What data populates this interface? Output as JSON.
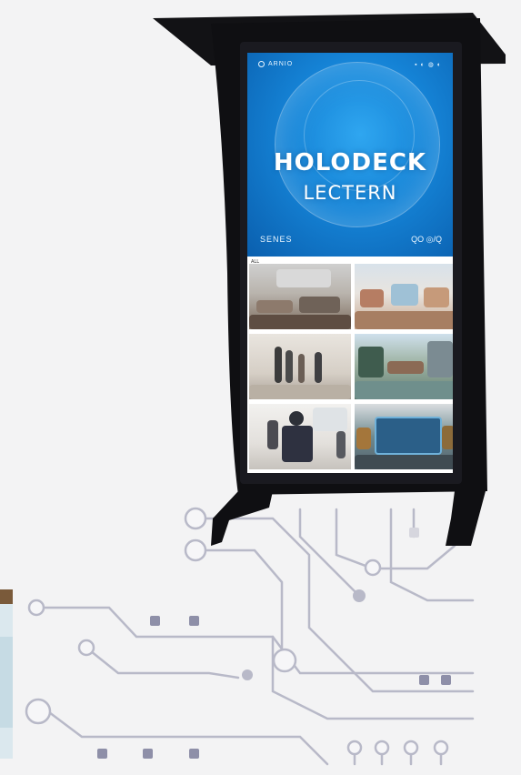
{
  "kiosk": {
    "logo_text": "ARNIO",
    "status_text": "▪ ◐ ◍ ◐",
    "title_line1": "HOLODECK",
    "title_line2": "LECTERN",
    "footer_left": "SENES",
    "footer_right": "QO ◎/Q",
    "grid_label": "ALL",
    "tiles": [
      "classroom",
      "lab-desk",
      "group-standing",
      "city-park",
      "lecture",
      "gallery-screen"
    ]
  },
  "colors": {
    "hero_blue": "#1583d6",
    "frame": "#111114",
    "circuit": "#a9aabd"
  }
}
